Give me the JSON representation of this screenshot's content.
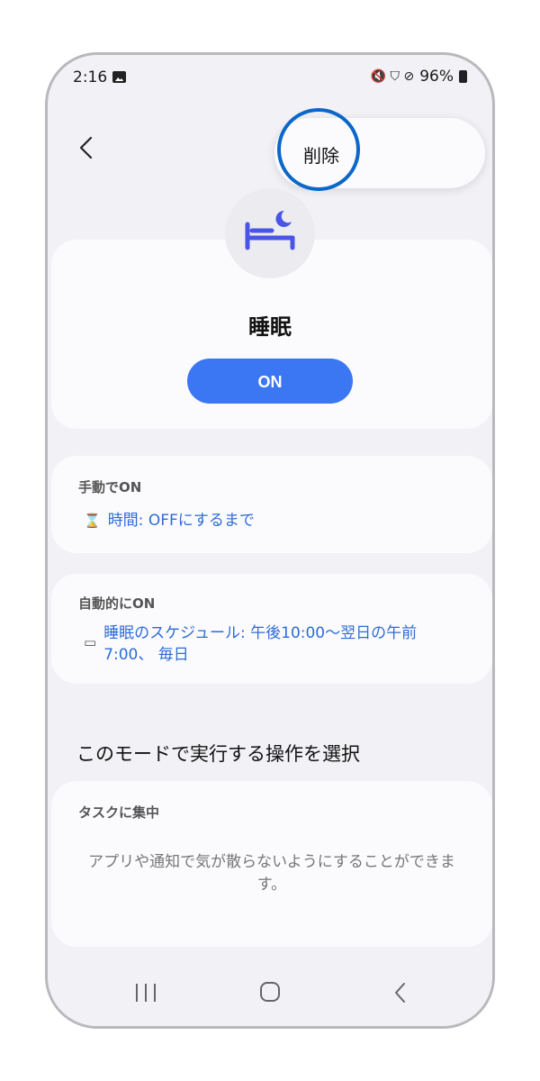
{
  "status_bar": {
    "time": "2:16",
    "right_icons": "🔇 ⛉ ⊘",
    "battery": "96%"
  },
  "popup_menu": {
    "delete_label": "削除"
  },
  "mode": {
    "icon": "bed-moon-icon",
    "title": "睡眠",
    "toggle_label": "ON"
  },
  "manual_section": {
    "label": "手動でON",
    "icon": "hourglass-icon",
    "link_text": "時間: OFFにするまで"
  },
  "auto_section": {
    "label": "自動的にON",
    "icon": "calendar-icon",
    "link_text": "睡眠のスケジュール: 午後10:00〜翌日の午前7:00、 毎日"
  },
  "actions_section": {
    "title": "このモードで実行する操作を選択"
  },
  "task_card": {
    "title": "タスクに集中",
    "description": "アプリや通知で気が散らないようにすることができます。"
  },
  "colors": {
    "accent": "#3b77f3",
    "link": "#2d6bd8",
    "highlight": "#0b67c8"
  }
}
